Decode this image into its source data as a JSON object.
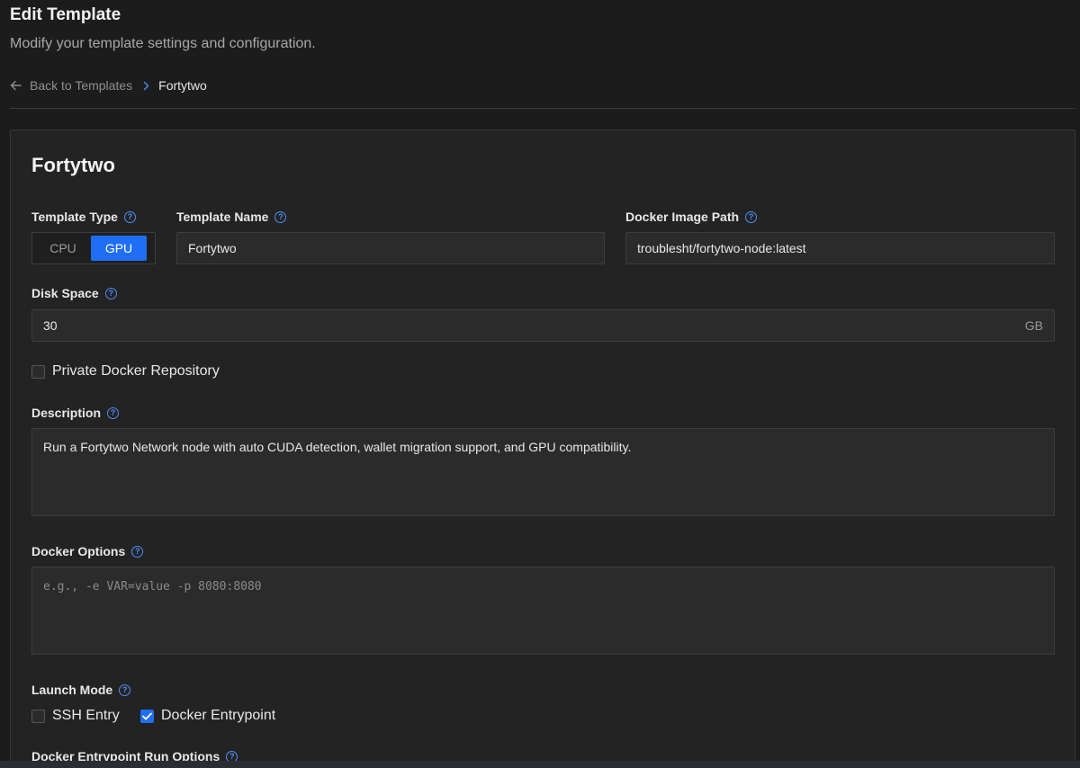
{
  "header": {
    "title": "Edit Template",
    "subtitle": "Modify your template settings and configuration."
  },
  "breadcrumb": {
    "back_label": "Back to Templates",
    "current": "Fortytwo"
  },
  "card": {
    "title": "Fortytwo"
  },
  "template_type": {
    "label": "Template Type",
    "options": [
      "CPU",
      "GPU"
    ],
    "selected": "GPU"
  },
  "template_name": {
    "label": "Template Name",
    "value": "Fortytwo"
  },
  "docker_image": {
    "label": "Docker Image Path",
    "value": "troublesht/fortytwo-node:latest"
  },
  "disk_space": {
    "label": "Disk Space",
    "value": "30",
    "unit": "GB"
  },
  "private_repo": {
    "label": "Private Docker Repository",
    "checked": false
  },
  "description": {
    "label": "Description",
    "value": "Run a Fortytwo Network node with auto CUDA detection, wallet migration support, and GPU compatibility."
  },
  "docker_options": {
    "label": "Docker Options",
    "placeholder": "e.g., -e VAR=value -p 8080:8080",
    "value": ""
  },
  "launch_mode": {
    "label": "Launch Mode",
    "ssh_label": "SSH Entry",
    "ssh_checked": false,
    "entrypoint_label": "Docker Entrypoint",
    "entrypoint_checked": true
  },
  "entrypoint_options": {
    "label": "Docker Entrypoint Run Options"
  },
  "colors": {
    "accent": "#1f6ef5",
    "background": "#1c1c1c",
    "card": "#232323",
    "help_icon": "#4f8ef7"
  },
  "icons": {
    "back": "arrow-left-icon",
    "separator": "chevron-right-icon",
    "help": "question-circle-icon",
    "check": "checkmark-icon"
  }
}
